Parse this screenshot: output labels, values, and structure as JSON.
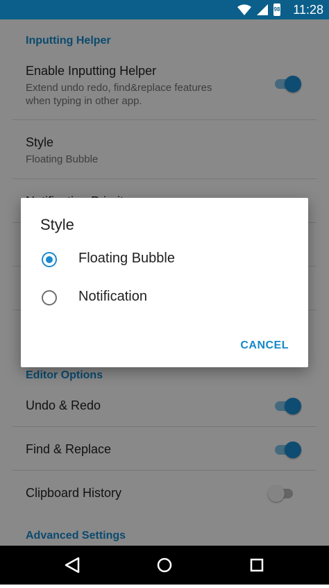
{
  "status_bar": {
    "time": "11:28",
    "battery": "98"
  },
  "settings": {
    "section_inputting": "Inputting Helper",
    "enable_helper": {
      "title": "Enable Inputting Helper",
      "subtitle_line1": "Extend undo redo, find&replace features",
      "subtitle_line2": "when typing in other app.",
      "enabled": true
    },
    "style": {
      "title": "Style",
      "subtitle": "Floating Bubble"
    },
    "partial_hidden_title": "Notification Priority",
    "section_editor": "Editor Options",
    "undo_redo": {
      "title": "Undo & Redo",
      "enabled": true
    },
    "find_replace": {
      "title": "Find & Replace",
      "enabled": true
    },
    "clipboard": {
      "title": "Clipboard History",
      "enabled": false
    },
    "section_advanced": "Advanced Settings"
  },
  "dialog": {
    "title": "Style",
    "options": [
      {
        "label": "Floating Bubble",
        "selected": true
      },
      {
        "label": "Notification",
        "selected": false
      }
    ],
    "cancel_label": "CANCEL"
  },
  "colors": {
    "status_bar": "#0b5f8a",
    "accent": "#1a8ad0",
    "header": "#1588c8"
  },
  "nav_icons": [
    "back-icon",
    "home-icon",
    "recents-icon"
  ]
}
